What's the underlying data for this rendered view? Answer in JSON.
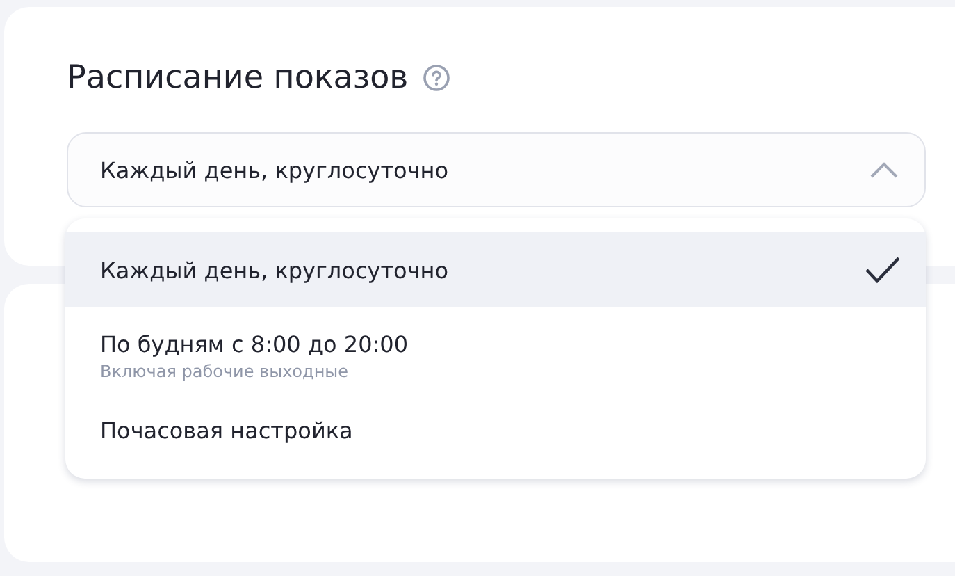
{
  "section": {
    "title": "Расписание показов"
  },
  "select": {
    "value": "Каждый день, круглосуточно",
    "expanded": true
  },
  "options": [
    {
      "label": "Каждый день, круглосуточно",
      "selected": true
    },
    {
      "label": "По будням с 8:00 до 20:00",
      "hint": "Включая рабочие выходные",
      "selected": false
    },
    {
      "label": "Почасовая настройка",
      "selected": false
    }
  ]
}
